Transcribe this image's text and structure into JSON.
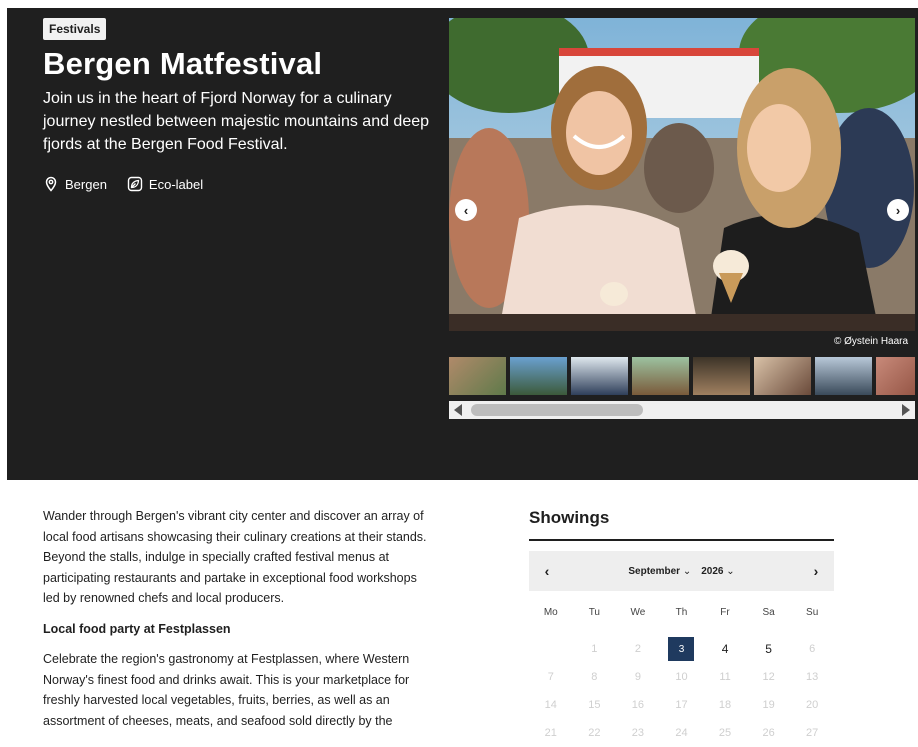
{
  "hero": {
    "badge": "Festivals",
    "title": "Bergen Matfestival",
    "lead": "Join us in the heart of Fjord Norway for a culinary journey nestled between majestic mountains and deep fjords at the Bergen Food Festival.",
    "location": "Bergen",
    "eco": "Eco-label",
    "credit": "© Øystein Haara",
    "background": "#1f1f1f"
  },
  "body": {
    "p1": "Wander through Bergen's vibrant city center and discover an array of local food artisans showcasing their culinary creations at their stands. Beyond the stalls, indulge in specially crafted festival menus at participating restaurants and partake in exceptional food workshops led by renowned chefs and local producers.",
    "h1": "Local food party at Festplassen",
    "p2": "Celebrate the region's gastronomy at Festplassen, where Western Norway's finest food and drinks await. This is your marketplace for freshly harvested local vegetables, fruits, berries, as well as an assortment of cheeses, meats, and seafood sold directly by the"
  },
  "showings": {
    "title": "Showings",
    "month": "September",
    "year": "2026",
    "prev": "‹",
    "next": "›",
    "weekdays": [
      "Mo",
      "Tu",
      "We",
      "Th",
      "Fr",
      "Sa",
      "Su"
    ],
    "weeks": [
      [
        "",
        "1",
        "2",
        "3",
        "4",
        "5",
        "6"
      ],
      [
        "7",
        "8",
        "9",
        "10",
        "11",
        "12",
        "13"
      ],
      [
        "14",
        "15",
        "16",
        "17",
        "18",
        "19",
        "20"
      ],
      [
        "21",
        "22",
        "23",
        "24",
        "25",
        "26",
        "27"
      ]
    ],
    "selected_day": "3",
    "available_days": [
      "3",
      "4",
      "5"
    ],
    "accent": "#1f3a5f"
  }
}
